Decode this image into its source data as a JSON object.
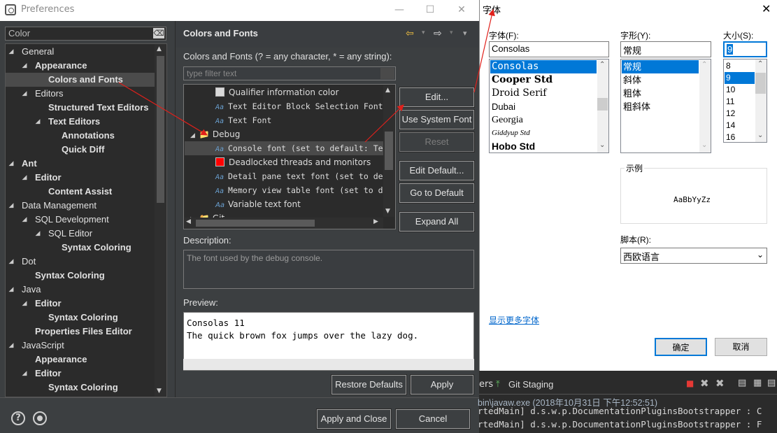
{
  "prefs": {
    "title": "Preferences",
    "window_controls": {
      "minimize": "—",
      "maximize": "☐",
      "close": "✕"
    },
    "filter_value": "Color",
    "filter_clear": "⌫",
    "tree": [
      {
        "label": "General",
        "arrow": "◢",
        "bold": false
      },
      {
        "label": "Appearance",
        "arrow": "◢",
        "bold": true
      },
      {
        "label": "Colors and Fonts",
        "arrow": "",
        "bold": true
      },
      {
        "label": "Editors",
        "arrow": "◢",
        "bold": false
      },
      {
        "label": "Structured Text Editors",
        "arrow": "",
        "bold": true
      },
      {
        "label": "Text Editors",
        "arrow": "◢",
        "bold": true
      },
      {
        "label": "Annotations",
        "arrow": "",
        "bold": true
      },
      {
        "label": "Quick Diff",
        "arrow": "",
        "bold": true
      },
      {
        "label": "Ant",
        "arrow": "◢",
        "bold": true
      },
      {
        "label": "Editor",
        "arrow": "◢",
        "bold": true
      },
      {
        "label": "Content Assist",
        "arrow": "",
        "bold": true
      },
      {
        "label": "Data Management",
        "arrow": "◢",
        "bold": false
      },
      {
        "label": "SQL Development",
        "arrow": "◢",
        "bold": false
      },
      {
        "label": "SQL Editor",
        "arrow": "◢",
        "bold": false
      },
      {
        "label": "Syntax Coloring",
        "arrow": "",
        "bold": true
      },
      {
        "label": "Dot",
        "arrow": "◢",
        "bold": false
      },
      {
        "label": "Syntax Coloring",
        "arrow": "",
        "bold": true
      },
      {
        "label": "Java",
        "arrow": "◢",
        "bold": false
      },
      {
        "label": "Editor",
        "arrow": "◢",
        "bold": true
      },
      {
        "label": "Syntax Coloring",
        "arrow": "",
        "bold": true
      },
      {
        "label": "Properties Files Editor",
        "arrow": "",
        "bold": true
      },
      {
        "label": "JavaScript",
        "arrow": "◢",
        "bold": false
      },
      {
        "label": "Appearance",
        "arrow": "",
        "bold": true
      },
      {
        "label": "Editor",
        "arrow": "◢",
        "bold": true
      },
      {
        "label": "Syntax Coloring",
        "arrow": "",
        "bold": true
      }
    ],
    "page": {
      "title": "Colors and Fonts",
      "back_icon": "⇦",
      "forward_icon": "⇨",
      "menu_icon": "▾",
      "caption": "Colors and Fonts (? = any character, * = any string):",
      "type_filter_placeholder": "type filter text",
      "color_items": [
        {
          "label": "Qualifier information color",
          "kind": "color",
          "color": "#d9d9d9",
          "mono": false
        },
        {
          "label": "Text Editor Block Selection Font",
          "kind": "font",
          "mono": true
        },
        {
          "label": "Text Font",
          "kind": "font",
          "mono": true
        },
        {
          "label": "Debug",
          "kind": "category",
          "mono": false
        },
        {
          "label": "Console font (set to default: Te",
          "kind": "font",
          "mono": true
        },
        {
          "label": "Deadlocked threads and monitors",
          "kind": "color",
          "color": "#ff0000",
          "mono": false
        },
        {
          "label": "Detail pane text font (set to de",
          "kind": "font",
          "mono": true
        },
        {
          "label": "Memory view table font (set to d",
          "kind": "font",
          "mono": true
        },
        {
          "label": "Variable text font",
          "kind": "font",
          "mono": false
        },
        {
          "label": "Git",
          "kind": "category",
          "mono": false
        }
      ],
      "font_icon_text": "Aa",
      "buttons": {
        "edit": "Edit...",
        "use_system_font": "Use System Font",
        "reset": "Reset",
        "edit_default": "Edit Default...",
        "go_to_default": "Go to Default",
        "expand_all": "Expand All"
      },
      "description_label": "Description:",
      "description_text": "The font used by the debug console.",
      "preview_label": "Preview:",
      "preview_lines": [
        "Consolas 11",
        "The quick brown fox jumps over the lazy dog."
      ],
      "restore_defaults": "Restore Defaults",
      "apply": "Apply"
    },
    "bottom": {
      "help_icon": "?",
      "apply_and_close": "Apply and Close",
      "cancel": "Cancel"
    }
  },
  "font_dialog": {
    "title": "字体",
    "close_icon": "✕",
    "font_label": "字体(F):",
    "style_label": "字形(Y):",
    "size_label": "大小(S):",
    "font_value": "Consolas",
    "style_value": "常规",
    "size_value": "9",
    "fonts": [
      "Consolas",
      "Cooper Std",
      "Droid Serif",
      "Dubai",
      "Georgia",
      "Giddyup Std",
      "Hobo Std"
    ],
    "styles": [
      "常规",
      "斜体",
      "粗体",
      "粗斜体"
    ],
    "sizes": [
      "8",
      "9",
      "10",
      "11",
      "12",
      "14",
      "16"
    ],
    "sample_label": "示例",
    "sample_text": "AaBbYyZz",
    "script_label": "脚本(R):",
    "script_value": "西欧语言",
    "more_fonts_link": "显示更多字体",
    "ok": "确定",
    "cancel": "取消"
  },
  "console": {
    "tab_partial": "ers",
    "git_staging": "Git Staging",
    "launch_line": "bin\\javaw.exe (2018年10月31日 下午12:52:51)",
    "lines": [
      "rtedMain] d.s.w.p.DocumentationPluginsBootstrapper : C",
      "rtedMain] d.s.w.p.DocumentationPluginsBootstrapper : F"
    ]
  },
  "colors": {
    "dark_bg": "#3c3f41",
    "selection_blue": "#0078d7",
    "annotation_red": "#e0201b"
  }
}
